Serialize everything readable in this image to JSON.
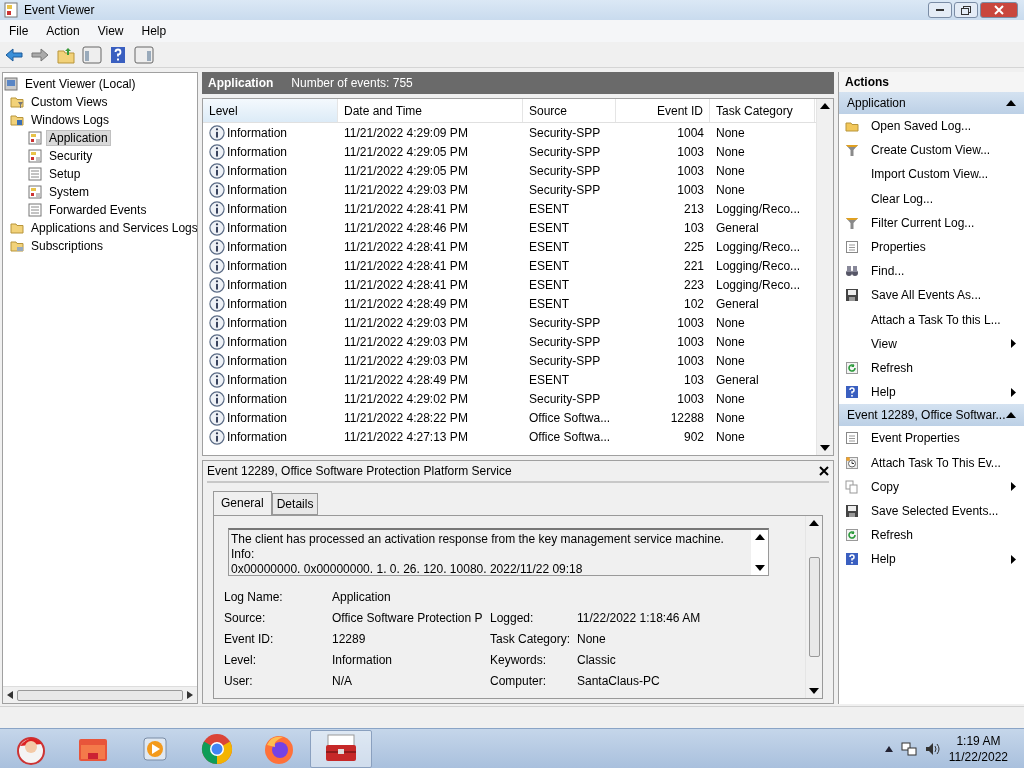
{
  "window": {
    "title": "Event Viewer"
  },
  "menu": [
    "File",
    "Action",
    "View",
    "Help"
  ],
  "tree": {
    "label": "Event Viewer (Local)",
    "selected": false,
    "children": [
      {
        "label": "Custom Views",
        "kind": "filter-folder",
        "selected": false
      },
      {
        "label": "Windows Logs",
        "kind": "log-folder",
        "selected": false,
        "children": [
          {
            "label": "Application",
            "kind": "log",
            "selected": true
          },
          {
            "label": "Security",
            "kind": "log",
            "selected": false
          },
          {
            "label": "Setup",
            "kind": "plain-log",
            "selected": false
          },
          {
            "label": "System",
            "kind": "log",
            "selected": false
          },
          {
            "label": "Forwarded Events",
            "kind": "plain-log",
            "selected": false
          }
        ]
      },
      {
        "label": "Applications and Services Logs",
        "kind": "folder",
        "selected": false
      },
      {
        "label": "Subscriptions",
        "kind": "sub-folder",
        "selected": false
      }
    ]
  },
  "log_header": {
    "title": "Application",
    "count": "Number of events: 755"
  },
  "table": {
    "columns": [
      "Level",
      "Date and Time",
      "Source",
      "Event ID",
      "Task Category"
    ],
    "rows": [
      [
        "Information",
        "11/21/2022 4:29:09 PM",
        "Security-SPP",
        "1004",
        "None"
      ],
      [
        "Information",
        "11/21/2022 4:29:05 PM",
        "Security-SPP",
        "1003",
        "None"
      ],
      [
        "Information",
        "11/21/2022 4:29:05 PM",
        "Security-SPP",
        "1003",
        "None"
      ],
      [
        "Information",
        "11/21/2022 4:29:03 PM",
        "Security-SPP",
        "1003",
        "None"
      ],
      [
        "Information",
        "11/21/2022 4:28:41 PM",
        "ESENT",
        "213",
        "Logging/Reco..."
      ],
      [
        "Information",
        "11/21/2022 4:28:46 PM",
        "ESENT",
        "103",
        "General"
      ],
      [
        "Information",
        "11/21/2022 4:28:41 PM",
        "ESENT",
        "225",
        "Logging/Reco..."
      ],
      [
        "Information",
        "11/21/2022 4:28:41 PM",
        "ESENT",
        "221",
        "Logging/Reco..."
      ],
      [
        "Information",
        "11/21/2022 4:28:41 PM",
        "ESENT",
        "223",
        "Logging/Reco..."
      ],
      [
        "Information",
        "11/21/2022 4:28:49 PM",
        "ESENT",
        "102",
        "General"
      ],
      [
        "Information",
        "11/21/2022 4:29:03 PM",
        "Security-SPP",
        "1003",
        "None"
      ],
      [
        "Information",
        "11/21/2022 4:29:03 PM",
        "Security-SPP",
        "1003",
        "None"
      ],
      [
        "Information",
        "11/21/2022 4:29:03 PM",
        "Security-SPP",
        "1003",
        "None"
      ],
      [
        "Information",
        "11/21/2022 4:28:49 PM",
        "ESENT",
        "103",
        "General"
      ],
      [
        "Information",
        "11/21/2022 4:29:02 PM",
        "Security-SPP",
        "1003",
        "None"
      ],
      [
        "Information",
        "11/21/2022 4:28:22 PM",
        "Office Softwa...",
        "12288",
        "None"
      ],
      [
        "Information",
        "11/21/2022 4:27:13 PM",
        "Office Softwa...",
        "902",
        "None"
      ]
    ]
  },
  "detail": {
    "title": "Event 12289, Office Software Protection Platform Service",
    "tabs": [
      {
        "label": "General",
        "selected": true
      },
      {
        "label": "Details",
        "selected": false
      }
    ],
    "message": [
      "The client has processed an activation response from the key management service machine.",
      "Info:",
      "0x00000000. 0x00000000. 1. 0. 26. 120. 10080. 2022/11/22 09:18"
    ],
    "fields": [
      [
        {
          "label": "Log Name:",
          "value": "Application"
        }
      ],
      [
        {
          "label": "Source:",
          "value": "Office Software Protection P"
        },
        {
          "label": "Logged:",
          "value": "11/22/2022 1:18:46 AM"
        }
      ],
      [
        {
          "label": "Event ID:",
          "value": "12289"
        },
        {
          "label": "Task Category:",
          "value": "None"
        }
      ],
      [
        {
          "label": "Level:",
          "value": "Information"
        },
        {
          "label": "Keywords:",
          "value": "Classic"
        }
      ],
      [
        {
          "label": "User:",
          "value": "N/A"
        },
        {
          "label": "Computer:",
          "value": "SantaClaus-PC"
        }
      ]
    ]
  },
  "actions": {
    "title": "Actions",
    "sections": [
      {
        "title": "Application",
        "expanded": true,
        "items": [
          {
            "label": "Open Saved Log...",
            "kind": "folder",
            "submenu": false
          },
          {
            "label": "Create Custom View...",
            "kind": "filter",
            "submenu": false
          },
          {
            "label": "Import Custom View...",
            "kind": "none",
            "submenu": false
          },
          {
            "label": "Clear Log...",
            "kind": "none",
            "submenu": false
          },
          {
            "label": "Filter Current Log...",
            "kind": "filter",
            "submenu": false
          },
          {
            "label": "Properties",
            "kind": "sheet",
            "submenu": false
          },
          {
            "label": "Find...",
            "kind": "binoculars",
            "submenu": false
          },
          {
            "label": "Save All Events As...",
            "kind": "disk",
            "submenu": false
          },
          {
            "label": "Attach a Task To this L...",
            "kind": "none",
            "submenu": false
          },
          {
            "label": "View",
            "kind": "none",
            "submenu": true
          },
          {
            "label": "Refresh",
            "kind": "refresh",
            "submenu": false
          },
          {
            "label": "Help",
            "kind": "help",
            "submenu": true
          }
        ]
      },
      {
        "title": "Event 12289, Office Softwar...",
        "expanded": true,
        "items": [
          {
            "label": "Event Properties",
            "kind": "sheet",
            "submenu": false
          },
          {
            "label": "Attach Task To This Ev...",
            "kind": "clock",
            "submenu": false
          },
          {
            "label": "Copy",
            "kind": "copy",
            "submenu": true
          },
          {
            "label": "Save Selected Events...",
            "kind": "disk",
            "submenu": false
          },
          {
            "label": "Refresh",
            "kind": "refresh",
            "submenu": false
          },
          {
            "label": "Help",
            "kind": "help",
            "submenu": true
          }
        ]
      }
    ]
  },
  "taskbar": {
    "apps": [
      {
        "kind": "start",
        "active": false
      },
      {
        "kind": "folder",
        "active": false
      },
      {
        "kind": "media",
        "active": false
      },
      {
        "kind": "chrome",
        "active": false
      },
      {
        "kind": "firefox",
        "active": false
      },
      {
        "kind": "toolbox",
        "active": true
      }
    ],
    "time": "1:19 AM",
    "date": "11/22/2022"
  }
}
